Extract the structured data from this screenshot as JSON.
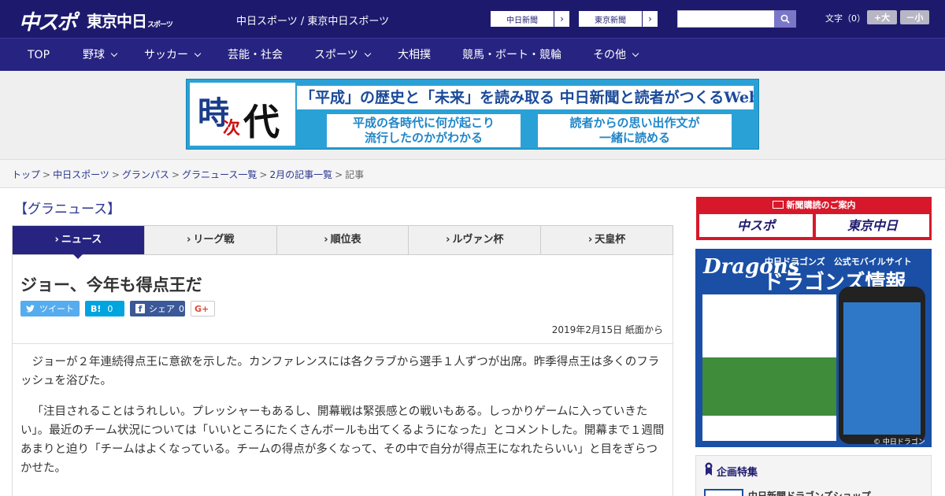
{
  "header": {
    "logo_primary": "中スポ",
    "logo_secondary": "東京中日",
    "logo_secondary_small": "スポーツ",
    "site_name": "中日スポーツ / 東京中日スポーツ",
    "buttons": [
      "中日新聞",
      "東京新聞"
    ],
    "search_placeholder": "",
    "font_label": "文字（0）",
    "font_larger": "+大",
    "font_smaller": "－小",
    "colors": {
      "primary": "#1d1a6e",
      "nav": "#272380"
    }
  },
  "nav": {
    "items": [
      {
        "label": "TOP",
        "has_menu": false
      },
      {
        "label": "野球",
        "has_menu": true
      },
      {
        "label": "サッカー",
        "has_menu": true
      },
      {
        "label": "芸能・社会",
        "has_menu": false
      },
      {
        "label": "スポーツ",
        "has_menu": true
      },
      {
        "label": "大相撲",
        "has_menu": false
      },
      {
        "label": "競馬・ボート・競輪",
        "has_menu": false
      },
      {
        "label": "その他",
        "has_menu": true
      }
    ]
  },
  "banner": {
    "brand_chars": [
      "時",
      "次",
      "代"
    ],
    "headline": "「平成」の歴史と「未来」を読み取る 中日新聞と読者がつくるWebサイト",
    "box_left": [
      "平成の各時代に何が起こり",
      "流行したのかがわかる"
    ],
    "box_right": [
      "読者からの思い出作文が",
      "一緒に読める"
    ]
  },
  "breadcrumb": {
    "links": [
      "トップ",
      "中日スポーツ",
      "グランパス",
      "グラニュース一覧",
      "2月の記事一覧"
    ],
    "current": "記事",
    "separator": ">"
  },
  "section_title": "【グラニュース】",
  "tabs": [
    {
      "label": "ニュース",
      "active": true
    },
    {
      "label": "リーグ戦",
      "active": false
    },
    {
      "label": "順位表",
      "active": false
    },
    {
      "label": "ルヴァン杯",
      "active": false
    },
    {
      "label": "天皇杯",
      "active": false
    }
  ],
  "article": {
    "title": "ジョー、今年も得点王だ",
    "share": {
      "tweet": "ツイート",
      "hatena_label": "B!",
      "hatena_count": "0",
      "facebook_label": "シェア",
      "facebook_count": "0",
      "gplus": "G+"
    },
    "date": "2019年2月15日 紙面から",
    "paragraphs": [
      "ジョーが２年連続得点王に意欲を示した。カンファレンスには各クラブから選手１人ずつが出席。昨季得点王は多くのフラッシュを浴びた。",
      "「注目されることはうれしい。プレッシャーもあるし、開幕戦は緊張感との戦いもある。しっかりゲームに入っていきたい」。最近のチーム状況については「いいところにたくさんボールも出てくるようになった」とコメントした。開幕まで１週間あまりと迫り「チームはよくなっている。チームの得点が多くなって、その中で自分が得点王になれたらいい」と目をぎらつかせた。"
    ]
  },
  "sidebar": {
    "subscription": {
      "header": "新聞購読のご案内",
      "left": "中スポ",
      "right": "東京中日"
    },
    "dragons_ad": {
      "logo": "Dragons",
      "subtitle": "中日ドラゴンズ　公式モバイルサイト",
      "title": "ドラゴンズ情報",
      "copyright": "© 中日ドラゴンズ"
    },
    "feature": {
      "title": "企画特集",
      "first_item": "中日新聞ドラゴンズショップ"
    }
  }
}
